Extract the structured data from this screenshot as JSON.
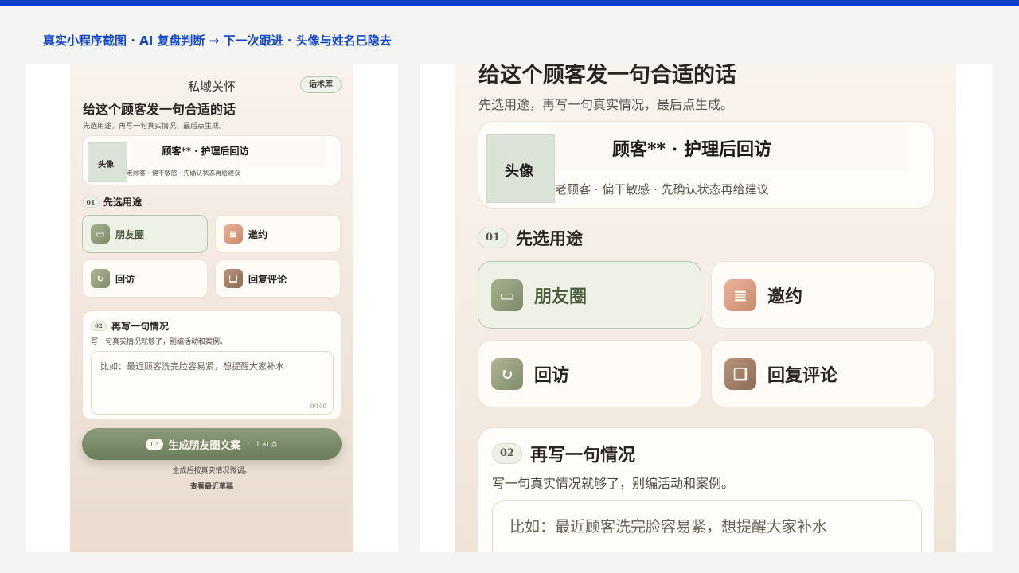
{
  "caption": "真实小程序截图 · AI 复盘判断 → 下一次跟进 · 头像与姓名已隐去",
  "colors": {
    "accent_blue": "#0a3ccc",
    "sage": "#7b8b6c",
    "cream": "#f8f3ec"
  },
  "app": {
    "title": "私域关怀",
    "library_button": "话术库",
    "heading": "给这个顾客发一句合适的话",
    "subheading": "先选用途，再写一句真实情况，最后点生成。"
  },
  "customer": {
    "name": "顾客** · 护理后回访",
    "avatar_label": "头像",
    "meta": "老顾客 · 偏干敏感 · 先确认状态再给建议"
  },
  "step1": {
    "number": "01",
    "title": "先选用途",
    "options": [
      {
        "label": "朋友圈",
        "icon": "moments-icon",
        "glyph": "▭",
        "selected": true
      },
      {
        "label": "邀约",
        "icon": "invite-note-icon",
        "glyph": "≣",
        "selected": false
      },
      {
        "label": "回访",
        "icon": "follow-up-icon",
        "glyph": "↻",
        "selected": false
      },
      {
        "label": "回复评论",
        "icon": "comment-reply-icon",
        "glyph": "❏",
        "selected": false
      }
    ]
  },
  "step2": {
    "number": "02",
    "title": "再写一句情况",
    "hint": "写一句真实情况就够了，别编活动和案例。",
    "placeholder": "比如：最近顾客洗完脸容易紧，想提醒大家补水",
    "counter": "0/100"
  },
  "generate": {
    "number": "03",
    "label": "生成朋友圈文案",
    "separator": "·",
    "cost": "1 AI 点"
  },
  "footer": {
    "note": "生成后按真实情况微调。",
    "drafts_link": "查看最近草稿"
  }
}
